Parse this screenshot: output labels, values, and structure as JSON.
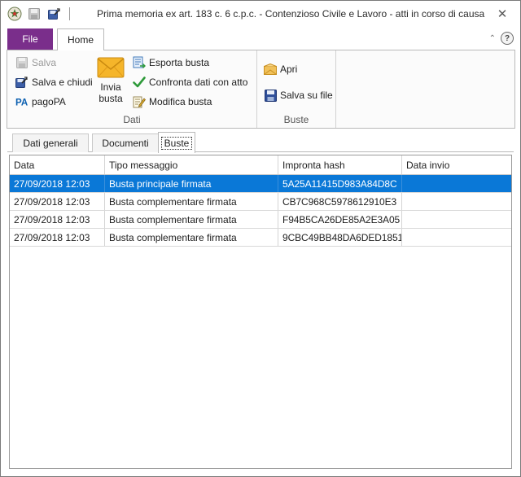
{
  "window": {
    "title": "Prima memoria ex art. 183 c. 6 c.p.c. - Contenzioso Civile e Lavoro - atti in corso di causa",
    "close_glyph": "✕"
  },
  "ribbon": {
    "tabs": {
      "file": "File",
      "home": "Home"
    },
    "help_glyph": "?",
    "collapse_glyph": "⌃",
    "dati": {
      "label": "Dati",
      "salva": "Salva",
      "salva_chiudi": "Salva e chiudi",
      "pagopa": "pagoPA",
      "invia_line1": "Invia",
      "invia_line2": "busta",
      "esporta": "Esporta busta",
      "confronta": "Confronta dati con atto",
      "modifica": "Modifica busta"
    },
    "buste": {
      "label": "Buste",
      "apri": "Apri",
      "salva_su_file": "Salva su file"
    }
  },
  "inner_tabs": [
    "Dati generali",
    "Documenti",
    "Buste"
  ],
  "grid": {
    "headers": [
      "Data",
      "Tipo messaggio",
      "Impronta hash",
      "Data invio"
    ],
    "rows": [
      [
        "27/09/2018 12:03",
        "Busta principale firmata",
        "5A25A11415D983A84D8C",
        ""
      ],
      [
        "27/09/2018 12:03",
        "Busta complementare firmata",
        "CB7C968C5978612910E3",
        ""
      ],
      [
        "27/09/2018 12:03",
        "Busta complementare firmata",
        "F94B5CA26DE85A2E3A05",
        ""
      ],
      [
        "27/09/2018 12:03",
        "Busta complementare firmata",
        "9CBC49BB48DA6DED1851",
        ""
      ]
    ]
  },
  "colors": {
    "file_tab": "#7a2e8b",
    "selection": "#0a78d7"
  }
}
